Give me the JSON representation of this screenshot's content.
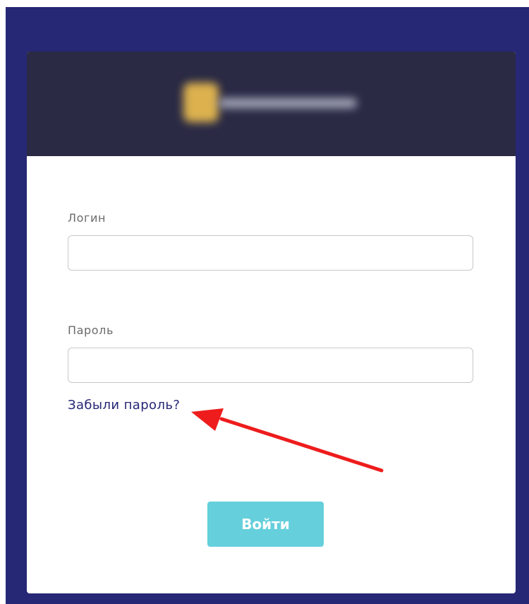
{
  "colors": {
    "page_background": "#262775",
    "header_background": "#2a2a45",
    "card_background": "#ffffff",
    "link": "#262775",
    "button_background": "#65cfdc",
    "button_text": "#ffffff",
    "annotation_arrow": "#ee1c1c"
  },
  "header": {
    "logo": "blurred-brand-logo"
  },
  "form": {
    "login_label": "Логин",
    "login_value": "",
    "password_label": "Пароль",
    "password_value": "",
    "forgot_password_link": "Забыли пароль?",
    "submit_label": "Войти"
  },
  "annotation": {
    "icon": "red-arrow-icon"
  }
}
